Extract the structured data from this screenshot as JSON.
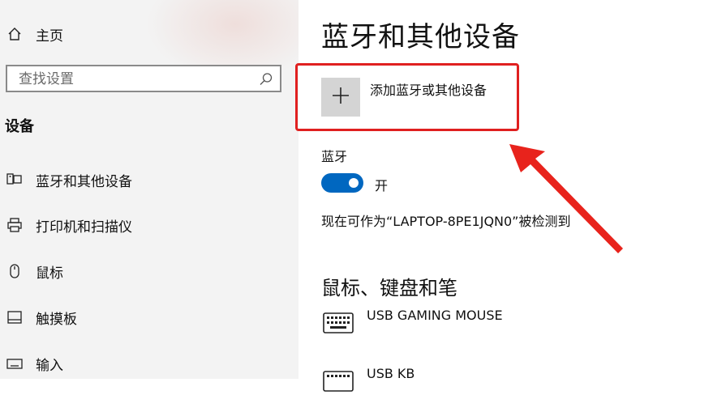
{
  "sidebar": {
    "home_label": "主页",
    "search_placeholder": "查找设置",
    "section_title": "设备",
    "items": [
      {
        "label": "蓝牙和其他设备",
        "icon": "bluetooth-devices-icon"
      },
      {
        "label": "打印机和扫描仪",
        "icon": "printer-icon"
      },
      {
        "label": "鼠标",
        "icon": "mouse-icon"
      },
      {
        "label": "触摸板",
        "icon": "touchpad-icon"
      },
      {
        "label": "输入",
        "icon": "keyboard-input-icon"
      }
    ]
  },
  "main": {
    "title": "蓝牙和其他设备",
    "add_device_label": "添加蓝牙或其他设备",
    "bluetooth": {
      "label": "蓝牙",
      "state": "开",
      "enabled": true,
      "discoverable_text": "现在可作为“LAPTOP-8PE1JQN0”被检测到"
    },
    "section_title": "鼠标、键盘和笔",
    "devices": [
      {
        "name": "USB GAMING MOUSE",
        "icon": "keyboard-icon"
      },
      {
        "name": "USB KB",
        "icon": "keyboard-icon"
      }
    ]
  },
  "colors": {
    "accent": "#0067c0",
    "annotation_red": "#e02020",
    "sidebar_bg": "#f3f3f3"
  }
}
